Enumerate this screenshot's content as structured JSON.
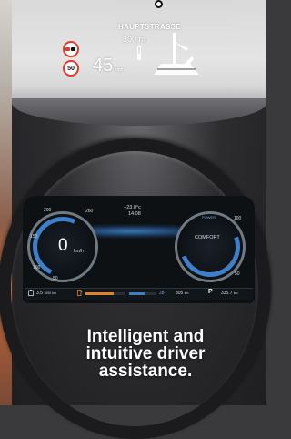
{
  "hud": {
    "street_name": "HAUPTSTRASSE",
    "distance_value": "300",
    "distance_unit": "m",
    "speed_value": "45",
    "speed_unit": "km/h",
    "speed_limit": "50"
  },
  "cluster": {
    "temperature": "+23.0°c",
    "time": "14:08",
    "speed_value": "0",
    "speed_unit": "km/h",
    "speed_ticks": [
      "50",
      "100",
      "150",
      "200",
      "260"
    ],
    "power_ticks": [
      "100",
      "50"
    ],
    "drive_mode_label": "POWER",
    "drive_mode": "COMFORT",
    "odometer": "3.5",
    "odometer_unit": "1000 km",
    "range_electric": "28",
    "range_total": "305",
    "range_total_unit": "km",
    "park_label": "P",
    "trip_distance": "335.7",
    "trip_unit": "km"
  },
  "headline": {
    "line1": "Intelligent and",
    "line2": "intuitive driver",
    "line3": "assistance."
  },
  "colors": {
    "accent_blue": "#3d7fc9",
    "sign_red": "#e03a2f",
    "energy_orange": "#e0822a"
  }
}
